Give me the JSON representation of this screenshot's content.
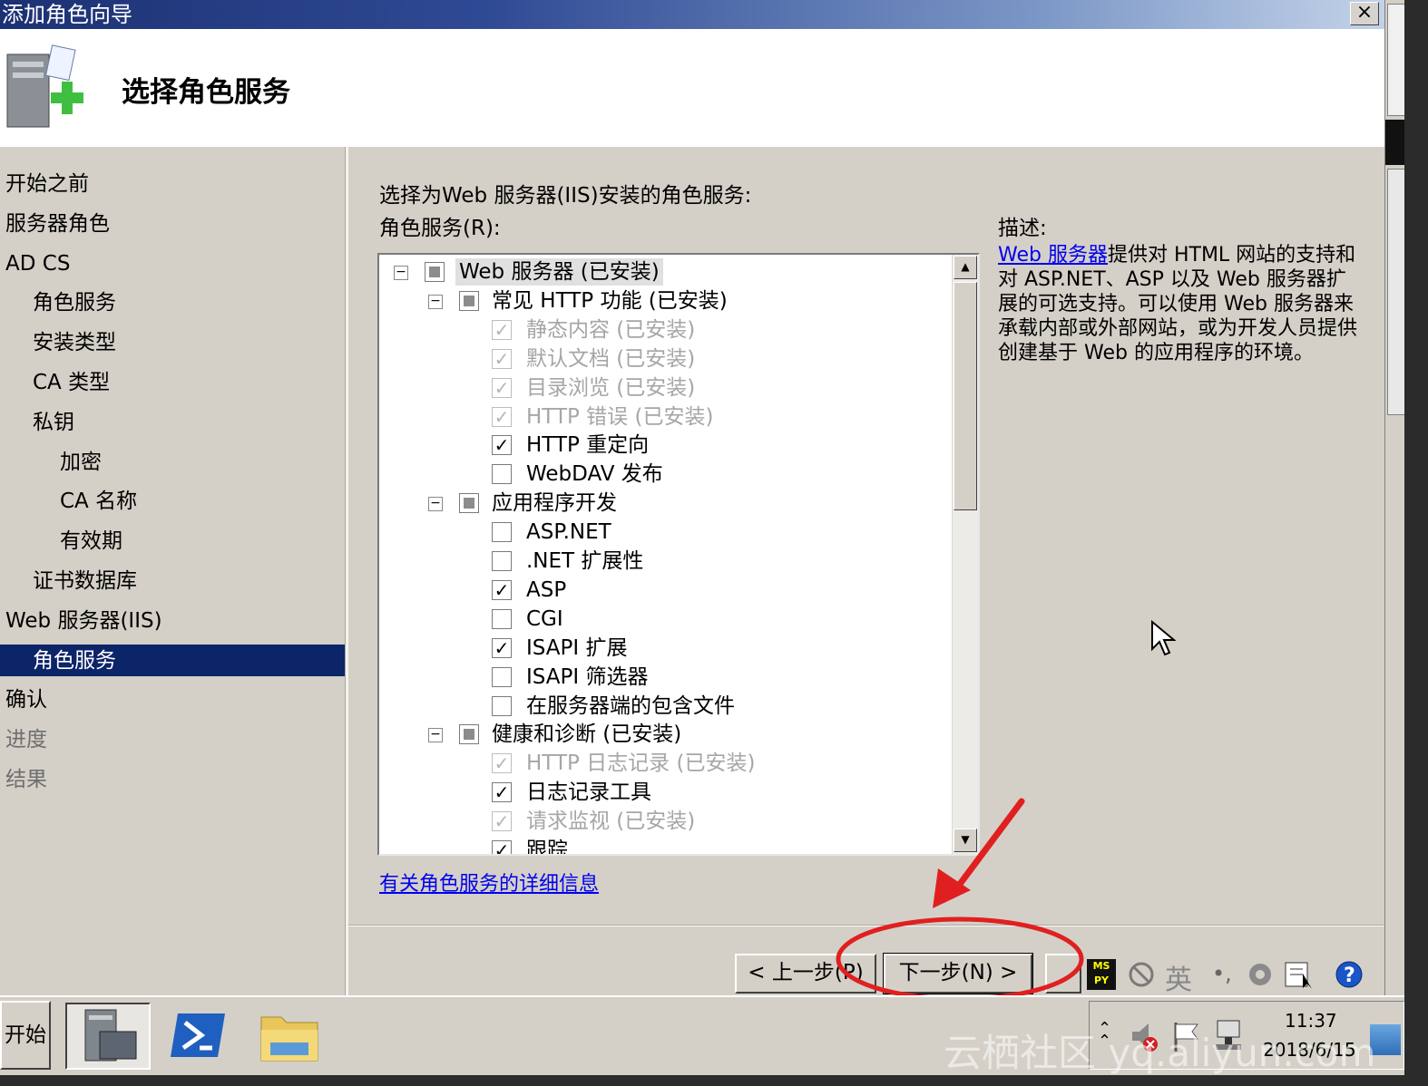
{
  "window": {
    "title": "添加角色向导",
    "close_label": "×"
  },
  "header": {
    "page_title": "选择角色服务"
  },
  "nav": [
    {
      "label": "开始之前",
      "state": "normal"
    },
    {
      "label": "服务器角色",
      "state": "normal"
    },
    {
      "label": "AD CS",
      "state": "normal"
    },
    {
      "label": "角色服务",
      "state": "normal"
    },
    {
      "label": "安装类型",
      "state": "normal"
    },
    {
      "label": "CA 类型",
      "state": "normal"
    },
    {
      "label": "私钥",
      "state": "normal"
    },
    {
      "label": "加密",
      "state": "normal"
    },
    {
      "label": "CA 名称",
      "state": "normal"
    },
    {
      "label": "有效期",
      "state": "normal"
    },
    {
      "label": "证书数据库",
      "state": "normal"
    },
    {
      "label": "Web 服务器(IIS)",
      "state": "normal"
    },
    {
      "label": "角色服务",
      "state": "selected"
    },
    {
      "label": "确认",
      "state": "normal"
    },
    {
      "label": "进度",
      "state": "disabled"
    },
    {
      "label": "结果",
      "state": "disabled"
    }
  ],
  "main": {
    "intro": "选择为Web 服务器(IIS)安装的角色服务:",
    "tree_label": "角色服务(R):",
    "tree": [
      {
        "label": "Web 服务器  (已安装)",
        "level": 0,
        "check": "partial",
        "expander": "⊟",
        "disabled": false
      },
      {
        "label": "常见 HTTP 功能  (已安装)",
        "level": 1,
        "check": "partial",
        "expander": "⊟",
        "disabled": false
      },
      {
        "label": "静态内容  (已安装)",
        "level": 2,
        "check": "checked",
        "disabled": true
      },
      {
        "label": "默认文档  (已安装)",
        "level": 2,
        "check": "checked",
        "disabled": true
      },
      {
        "label": "目录浏览  (已安装)",
        "level": 2,
        "check": "checked",
        "disabled": true
      },
      {
        "label": "HTTP 错误  (已安装)",
        "level": 2,
        "check": "checked",
        "disabled": true
      },
      {
        "label": "HTTP 重定向",
        "level": 2,
        "check": "checked",
        "disabled": false
      },
      {
        "label": "WebDAV 发布",
        "level": 2,
        "check": "unchecked",
        "disabled": false
      },
      {
        "label": "应用程序开发",
        "level": 1,
        "check": "partial",
        "expander": "⊟",
        "disabled": false
      },
      {
        "label": "ASP.NET",
        "level": 2,
        "check": "unchecked",
        "disabled": false
      },
      {
        "label": ".NET 扩展性",
        "level": 2,
        "check": "unchecked",
        "disabled": false
      },
      {
        "label": "ASP",
        "level": 2,
        "check": "checked",
        "disabled": false
      },
      {
        "label": "CGI",
        "level": 2,
        "check": "unchecked",
        "disabled": false
      },
      {
        "label": "ISAPI 扩展",
        "level": 2,
        "check": "checked",
        "disabled": false
      },
      {
        "label": "ISAPI 筛选器",
        "level": 2,
        "check": "unchecked",
        "disabled": false
      },
      {
        "label": "在服务器端的包含文件",
        "level": 2,
        "check": "unchecked",
        "disabled": false
      },
      {
        "label": "健康和诊断  (已安装)",
        "level": 1,
        "check": "partial",
        "expander": "⊟",
        "disabled": false
      },
      {
        "label": "HTTP 日志记录  (已安装)",
        "level": 2,
        "check": "checked",
        "disabled": true
      },
      {
        "label": "日志记录工具",
        "level": 2,
        "check": "checked",
        "disabled": false
      },
      {
        "label": "请求监视  (已安装)",
        "level": 2,
        "check": "checked",
        "disabled": true
      },
      {
        "label": "跟踪",
        "level": 2,
        "check": "checked",
        "disabled": false
      }
    ],
    "more_info_link": "有关角色服务的详细信息",
    "description": {
      "label": "描述:",
      "link": "Web 服务器",
      "text": "提供对 HTML 网站的支持和对 ASP.NET、ASP 以及 Web 服务器扩展的可选支持。可以使用 Web 服务器来承载内部或外部网站，或为开发人员提供创建基于 Web 的应用程序的环境。"
    }
  },
  "footer": {
    "back_label": "< 上一步(P)",
    "next_label": "下一步(N) >"
  },
  "ime": {
    "lang": "英"
  },
  "taskbar": {
    "start_label": "开始",
    "time": "11:37",
    "date": "2018/6/15"
  },
  "watermark": "云栖社区 yq.aliyun.com",
  "colors": {
    "accent": "#0c2468",
    "annotation": "#e02020",
    "link": "#0000ee"
  }
}
